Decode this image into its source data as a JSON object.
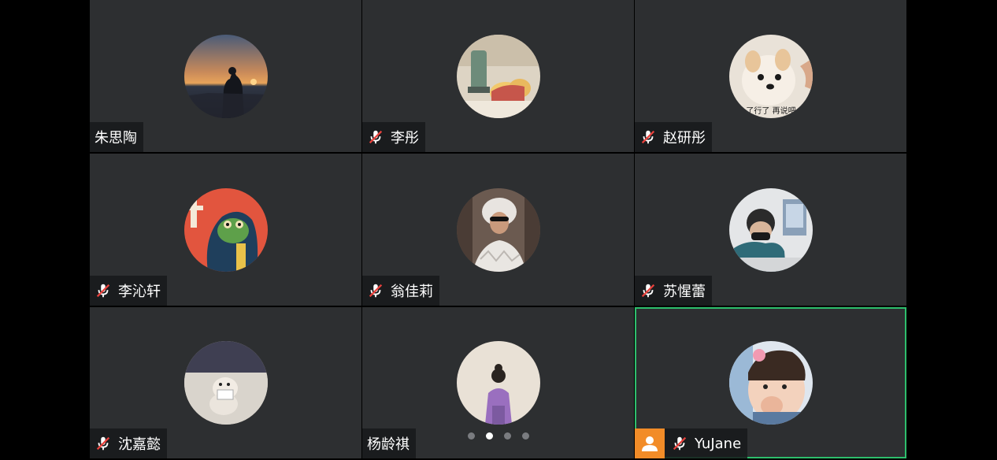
{
  "participants": [
    {
      "name": "朱思陶",
      "muted": false
    },
    {
      "name": "李彤",
      "muted": true
    },
    {
      "name": "赵研彤",
      "muted": true
    },
    {
      "name": "李沁轩",
      "muted": true
    },
    {
      "name": "翁佳莉",
      "muted": true
    },
    {
      "name": "苏惺蕾",
      "muted": true
    },
    {
      "name": "沈嘉懿",
      "muted": true
    },
    {
      "name": "杨龄祺",
      "muted": false
    },
    {
      "name": "YuJane",
      "muted": true,
      "is_self": true,
      "active_speaker": true
    }
  ],
  "avatar_captions": {
    "dog_meme": "了行了 再说吧"
  },
  "pagination": {
    "total_pages": 4,
    "current_page": 2
  },
  "colors": {
    "tile_bg": "#2d2f31",
    "active_border": "#2dbe6c",
    "self_badge": "#f28c28",
    "mute_slash": "#e8413c"
  },
  "icons": {
    "mic_off": "mic-off-icon",
    "self_user": "user-icon"
  }
}
